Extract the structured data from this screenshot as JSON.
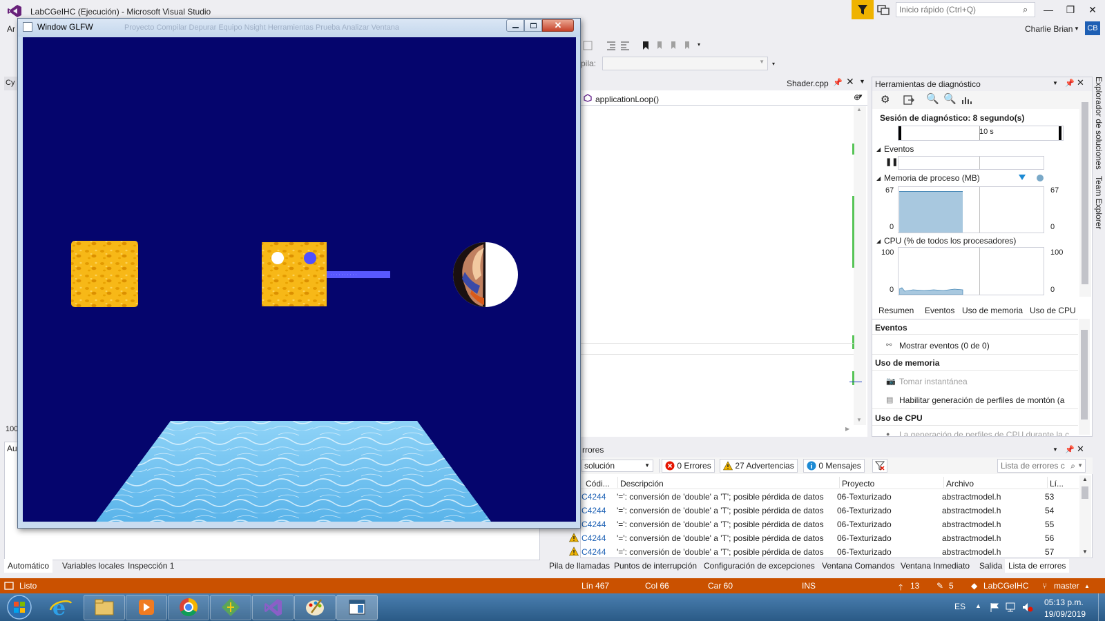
{
  "window": {
    "title": "LabCGeIHC (Ejecución) - Microsoft Visual Studio",
    "quick_launch_placeholder": "Inicio rápido (Ctrl+Q)",
    "user_name": "Charlie Brian",
    "user_initials": "CB",
    "menu_stub": "Ar"
  },
  "glfw_window": {
    "title": "Window GLFW",
    "ghost_menu": "Proyecto   Compilar   Depurar   Equipo   Nsight   Herramientas   Prueba   Analizar   Ventana",
    "close_glyph": "✕",
    "scene_bg": "#05056d"
  },
  "toolbar": {
    "stack_label": "pila:"
  },
  "left_dock": {
    "tab_stub": "Cy",
    "value_stub": "100",
    "autos_stub": "Au"
  },
  "editor": {
    "tab_label": "Shader.cpp",
    "function": "applicationLoop()"
  },
  "diagnostics": {
    "title": "Herramientas de diagnóstico",
    "session": "Sesión de diagnóstico: 8 segundo(s)",
    "timeline_label": "10 s",
    "events_label": "Eventos",
    "memory_label": "Memoria de proceso (MB)",
    "memory_max": "67",
    "memory_min": "0",
    "cpu_label": "CPU (% de todos los procesadores)",
    "cpu_max": "100",
    "cpu_min": "0",
    "tabs": [
      "Resumen",
      "Eventos",
      "Uso de memoria",
      "Uso de CPU"
    ],
    "groups": {
      "events": "Eventos",
      "show_events": "Mostrar eventos (0 de 0)",
      "memory": "Uso de memoria",
      "snapshot": "Tomar instantánea",
      "heap": "Habilitar generación de perfiles de montón (a",
      "cpu": "Uso de CPU",
      "cpu_note": "La generación de perfiles de CPU durante la c"
    }
  },
  "vertical_tabs": {
    "solutions": "Explorador de soluciones",
    "team": "Team Explorer"
  },
  "error_list": {
    "title": "rrores",
    "scope": "solución",
    "errors_btn": "0 Errores",
    "warnings_btn": "27 Advertencias",
    "messages_btn": "0 Mensajes",
    "search_placeholder": "Lista de errores c",
    "headers": {
      "code": "Códi...",
      "description": "Descripción",
      "project": "Proyecto",
      "file": "Archivo",
      "line": "Lí..."
    },
    "rows": [
      {
        "code": "C4244",
        "description": "'=': conversión de 'double' a 'T'; posible pérdida de datos",
        "project": "06-Texturizado",
        "file": "abstractmodel.h",
        "line": "53"
      },
      {
        "code": "C4244",
        "description": "'=': conversión de 'double' a 'T'; posible pérdida de datos",
        "project": "06-Texturizado",
        "file": "abstractmodel.h",
        "line": "54"
      },
      {
        "code": "C4244",
        "description": "'=': conversión de 'double' a 'T'; posible pérdida de datos",
        "project": "06-Texturizado",
        "file": "abstractmodel.h",
        "line": "55"
      },
      {
        "code": "C4244",
        "description": "'=': conversión de 'double' a 'T'; posible pérdida de datos",
        "project": "06-Texturizado",
        "file": "abstractmodel.h",
        "line": "56"
      },
      {
        "code": "C4244",
        "description": "'=': conversión de 'double' a 'T'; posible pérdida de datos",
        "project": "06-Texturizado",
        "file": "abstractmodel.h",
        "line": "57"
      }
    ]
  },
  "bottom_tabs_left": [
    "Automático",
    "Variables locales",
    "Inspección 1"
  ],
  "bottom_tabs_right": [
    "Pila de llamadas",
    "Puntos de interrupción",
    "Configuración de excepciones",
    "Ventana Comandos",
    "Ventana Inmediato",
    "Salida",
    "Lista de errores"
  ],
  "status_bar": {
    "state": "Listo",
    "line": "Lín 467",
    "col": "Col 66",
    "char": "Car 60",
    "mode": "INS",
    "pending": "13",
    "changes": "5",
    "repo": "LabCGeIHC",
    "branch": "master",
    "color": "#ca5100"
  },
  "taskbar": {
    "lang": "ES",
    "time": "05:13 p.m.",
    "date": "19/09/2019",
    "apps": [
      "windows-start",
      "internet-explorer",
      "file-explorer",
      "media-player",
      "chrome",
      "git-tool",
      "visual-studio",
      "paint",
      "glfw-app"
    ]
  }
}
